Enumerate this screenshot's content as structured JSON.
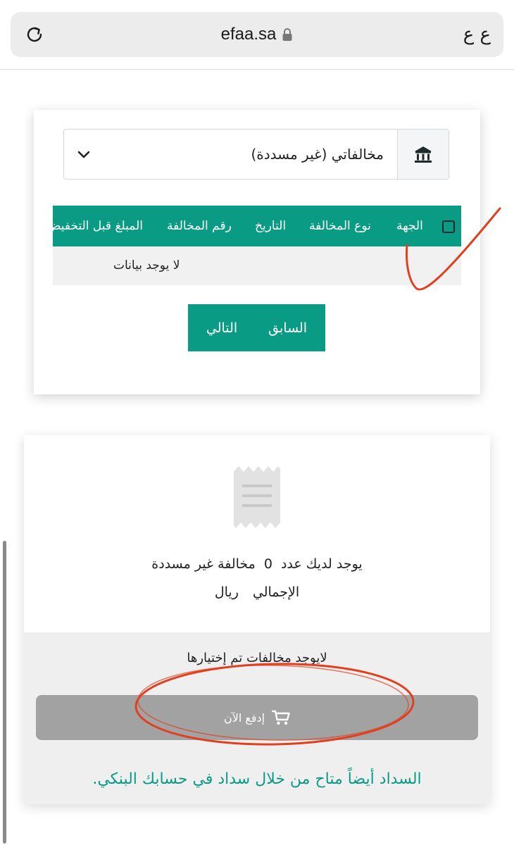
{
  "browser": {
    "url": "efaa.sa",
    "text_size_label": "ع ع",
    "icons": {
      "reload": "reload-icon",
      "lock": "lock-icon"
    }
  },
  "violations_card": {
    "select": {
      "value": "مخالفاتي (غير مسددة)",
      "icon": "bank-icon"
    },
    "table": {
      "headers": [
        "الجهة",
        "نوع المخالفة",
        "التاريخ",
        "رقم المخالفة",
        "المبلغ قبل التخفيض"
      ],
      "empty_message": "لا يوجد بيانات"
    },
    "pager": {
      "previous": "السابق",
      "next": "التالي"
    }
  },
  "summary_card": {
    "count_prefix": "يوجد لديك عدد",
    "count_value": "0",
    "count_suffix": "مخالفة غير مسددة",
    "total_label": "الإجمالي",
    "total_currency": "ريال",
    "none_selected": "لايوجد مخالفات تم إختيارها",
    "pay_button": "إدفع الآن",
    "bank_note": "السداد أيضاً متاح من خلال سداد في حسابك البنكي."
  },
  "colors": {
    "accent": "#0a9b85",
    "annotation": "#e0401f",
    "pay_disabled": "#a2a2a2"
  }
}
